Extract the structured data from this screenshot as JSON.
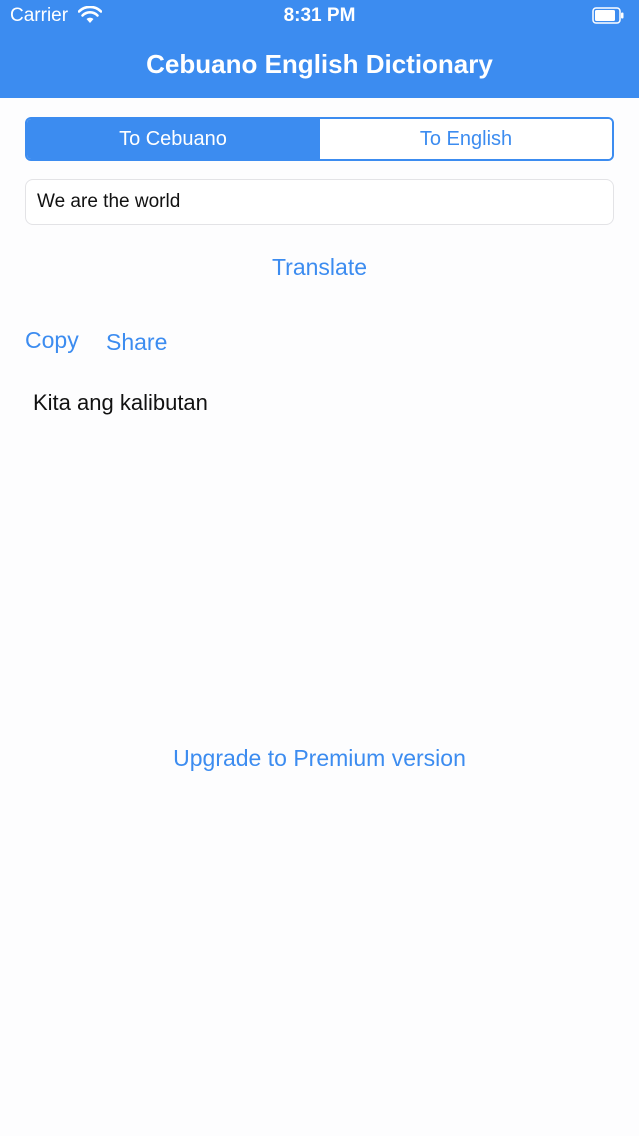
{
  "status_bar": {
    "carrier": "Carrier",
    "time": "8:31 PM",
    "icons": [
      "wifi-icon",
      "battery-icon"
    ]
  },
  "header": {
    "title": "Cebuano English Dictionary",
    "background_color": "#3c8cf0"
  },
  "segmented_control": {
    "options": [
      {
        "label": "To Cebuano",
        "selected": true
      },
      {
        "label": "To English",
        "selected": false
      }
    ]
  },
  "input": {
    "value": "We are the world"
  },
  "actions": {
    "translate_label": "Translate",
    "copy_label": "Copy",
    "share_label": "Share"
  },
  "result": {
    "text": "Kita ang kalibutan"
  },
  "footer": {
    "upgrade_label": "Upgrade to Premium version"
  },
  "colors": {
    "accent": "#3c8cf0",
    "text": "#111111",
    "background": "#fdfdfe"
  }
}
